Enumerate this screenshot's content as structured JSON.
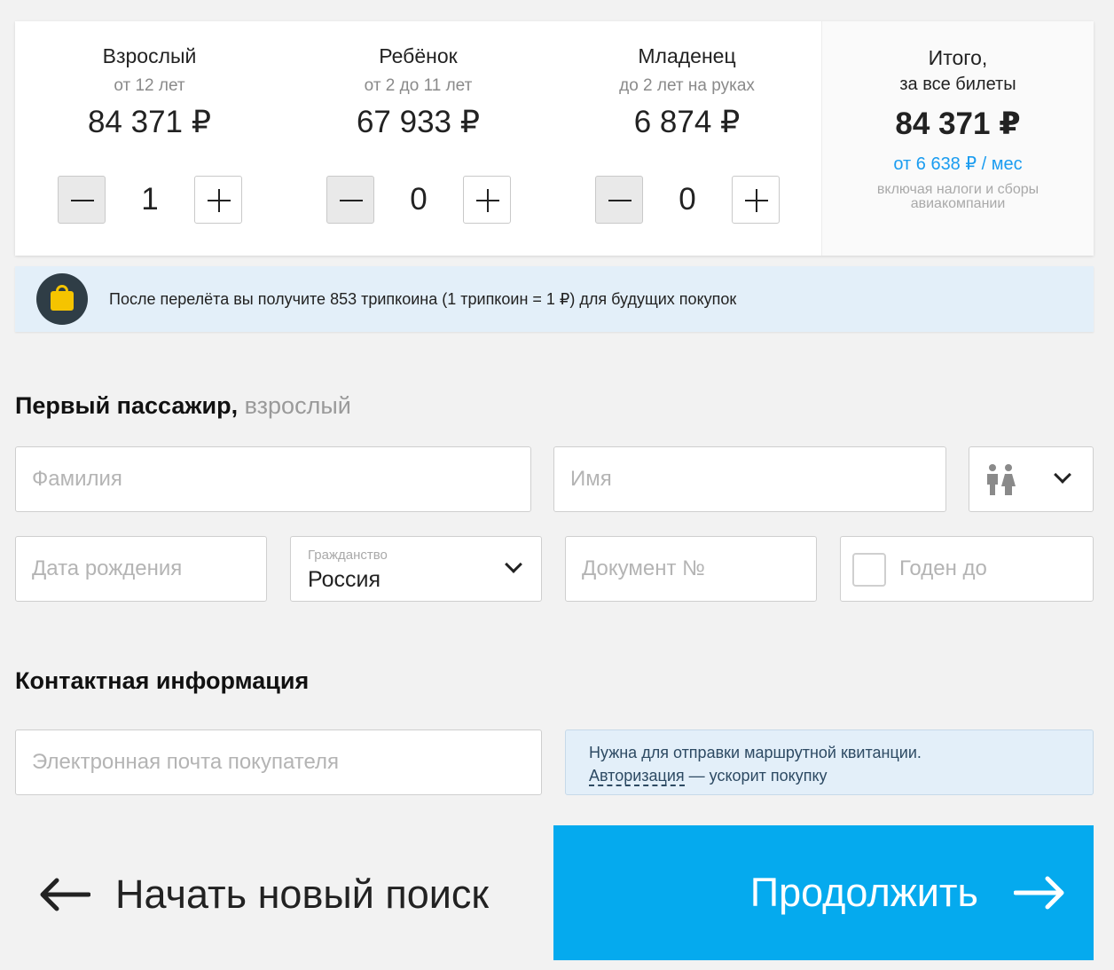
{
  "fares": [
    {
      "title": "Взрослый",
      "subtitle": "от 12 лет",
      "price": "84 371 ₽",
      "count": "1"
    },
    {
      "title": "Ребёнок",
      "subtitle": "от 2 до 11 лет",
      "price": "67 933 ₽",
      "count": "0"
    },
    {
      "title": "Младенец",
      "subtitle": "до 2 лет на руках",
      "price": "6 874 ₽",
      "count": "0"
    }
  ],
  "total": {
    "title": "Итого,",
    "subtitle": "за все билеты",
    "price": "84 371 ₽",
    "monthly": "от 6 638 ₽ / мес",
    "note": "включая налоги и сборы авиакомпании"
  },
  "coins_banner": {
    "text": "После перелёта вы получите 853 трипкоина (1 трипкоин = 1 ₽) для будущих покупок"
  },
  "passenger": {
    "title": "Первый пассажир,",
    "title_suffix": "взрослый",
    "last_name_placeholder": "Фамилия",
    "first_name_placeholder": "Имя",
    "birth_date_placeholder": "Дата рождения",
    "citizenship_label": "Гражданство",
    "citizenship_value": "Россия",
    "document_placeholder": "Документ №",
    "valid_until_label": "Годен до"
  },
  "contact": {
    "title": "Контактная информация",
    "email_placeholder": "Электронная почта покупателя",
    "hint_text": "Нужна для отправки маршрутной квитанции.",
    "auth_link": "Авторизация",
    "auth_suffix": " — ускорит покупку"
  },
  "actions": {
    "new_search": "Начать новый поиск",
    "continue": "Продолжить"
  }
}
